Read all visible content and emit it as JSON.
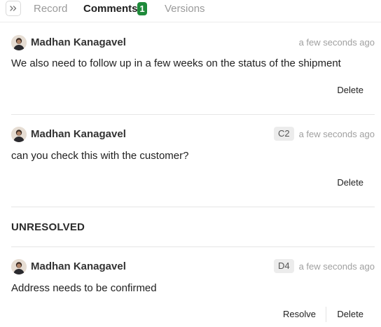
{
  "tabs": {
    "record": "Record",
    "comments": "Comments",
    "comments_count": "1",
    "versions": "Versions"
  },
  "comments": [
    {
      "author": "Madhan Kanagavel",
      "time": "a few seconds ago",
      "text": "We also need to follow up in a few weeks on the status of the shipment",
      "actions": [
        "Delete"
      ]
    },
    {
      "author": "Madhan Kanagavel",
      "ref": "C2",
      "time": "a few seconds ago",
      "text": "can you check this with the customer?",
      "actions": [
        "Delete"
      ]
    }
  ],
  "unresolved": {
    "title": "UNRESOLVED",
    "comments": [
      {
        "author": "Madhan Kanagavel",
        "ref": "D4",
        "time": "a few seconds ago",
        "text": "Address needs to be confirmed",
        "actions": [
          "Resolve",
          "Delete"
        ]
      }
    ]
  },
  "icons": {
    "collapse": "double-chevron-right-icon",
    "avatar": "user-avatar-photo"
  },
  "colors": {
    "badge_green": "#1e8a3a",
    "muted_text": "#a0a0a0"
  }
}
